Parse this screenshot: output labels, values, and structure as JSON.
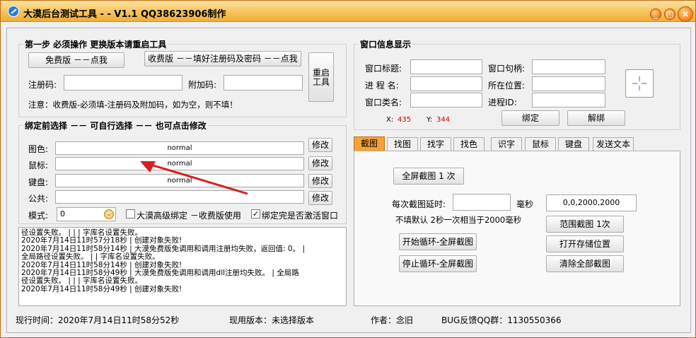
{
  "window": {
    "title": "大漠后台测试工具 - - V1.1  QQ38623906制作",
    "buttons": [
      "_",
      "▢",
      "×"
    ]
  },
  "step1": {
    "title": "第一步 必须操作  更换版本请重启工具",
    "free_btn": "免费版 －－点我",
    "paid_btn": "收费版 －－填好注册码及密码 －－点我",
    "restart_btn": "重启工具",
    "reg_label": "注册码:",
    "reg_value": "",
    "addcode_label": "附加码:",
    "addcode_value": "",
    "note": "注意：收费版-必须填-注册码及附加码，如为空，则不填！"
  },
  "bind": {
    "title": "绑定前选择 －－ 可自行选择 －－ 也可点击修改",
    "rows": [
      {
        "label": "图色:",
        "value": "normal",
        "btn": "修改"
      },
      {
        "label": "鼠标:",
        "value": "normal",
        "btn": "修改"
      },
      {
        "label": "键盘:",
        "value": "normal",
        "btn": "修改"
      },
      {
        "label": "公共:",
        "value": "",
        "btn": "修改"
      }
    ],
    "mode_label": "模式:",
    "mode_value": "0",
    "adv_label": "大漠高级绑定 －收费版使用",
    "adv_checked": false,
    "activate_label": "绑定完是否激活窗口",
    "activate_checked": true
  },
  "log": [
    "径设置失败。  |   |   | 字库名设置失败。",
    "2020年7月14日11时57分18秒  |   创建对象失败!",
    "2020年7月14日11时58分14秒  |   大漠免费版免调用和调用注册均失败，返回值: 0。  |",
    "全局路径设置失败。  |   | 字库名设置失败。",
    "2020年7月14日11时58分14秒  |   创建对象失败!",
    "2020年7月14日11时58分49秒  |   大漠免费版免调用和调用dll注册均失败。  | 全局路",
    "径设置失败。  |   |   | 字库名设置失败。",
    "2020年7月14日11时58分49秒  |   创建对象失败!"
  ],
  "wininfo": {
    "title": "窗口信息显示",
    "title_label": "窗口标题:",
    "handle_label": "窗口句柄:",
    "proc_label": "进 程 名:",
    "pos_label": "所在位置:",
    "class_label": "窗口类名:",
    "pid_label": "进程ID:",
    "x_label": "X:",
    "x_value": "435",
    "y_label": "Y:",
    "y_value": "344",
    "bind_btn": "绑定",
    "unbind_btn": "解绑"
  },
  "tabs": [
    "截图",
    "找图",
    "找字",
    "找色",
    "识字",
    "鼠标",
    "键盘",
    "发送文本"
  ],
  "capture": {
    "full_btn": "全屏截图 1 次",
    "delay_label": "每次截图延时:",
    "delay_value": "",
    "ms_label": "毫秒",
    "range_value": "0,0,2000,2000",
    "note": "不填默认 2秒一次相当于2000毫秒",
    "range_btn": "范围截图 1次",
    "loop_start_btn": "开始循环-全屏截图",
    "open_btn": "打开存储位置",
    "loop_stop_btn": "停止循环-全屏截图",
    "clear_btn": "清除全部截图"
  },
  "status": {
    "time": "现行时间：2020年7月14日11时58分52秒",
    "version": "现用版本：未选择版本",
    "author": "作者：念旧",
    "qq": "BUG反馈QQ群：1130550366"
  },
  "colors": {
    "accent": "#f7a234",
    "title_bg": "#f6c35c",
    "red": "#d00000",
    "arrow": "#d42020"
  }
}
